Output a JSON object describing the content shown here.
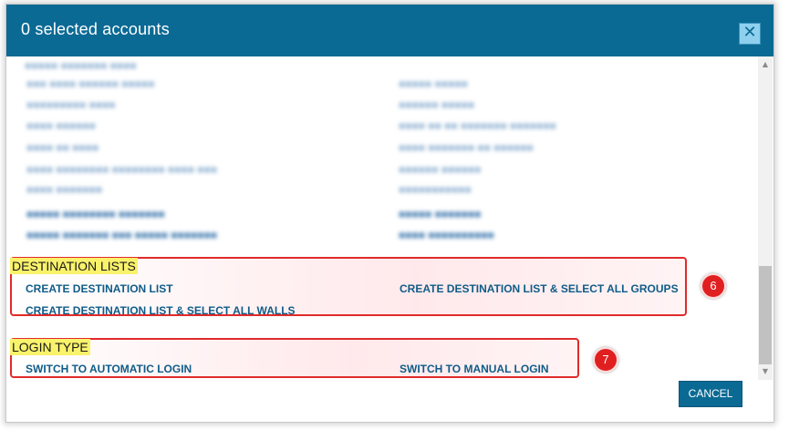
{
  "dialog": {
    "title": "0 selected accounts",
    "close_icon": "close-icon",
    "cancel_label": "CANCEL"
  },
  "destination_lists": {
    "heading": "DESTINATION LISTS",
    "create_list": "CREATE DESTINATION LIST",
    "create_list_all_groups": "CREATE DESTINATION LIST & SELECT ALL GROUPS",
    "create_list_all_walls": "CREATE DESTINATION LIST & SELECT ALL WALLS",
    "badge": "6"
  },
  "login_type": {
    "heading": "LOGIN TYPE",
    "switch_automatic": "SWITCH TO AUTOMATIC LOGIN",
    "switch_manual": "SWITCH TO MANUAL LOGIN",
    "badge": "7"
  },
  "colors": {
    "header": "#0b6a94",
    "link": "#0f5c88",
    "highlight": "#f9f26b",
    "annotation": "#e12a2a"
  }
}
